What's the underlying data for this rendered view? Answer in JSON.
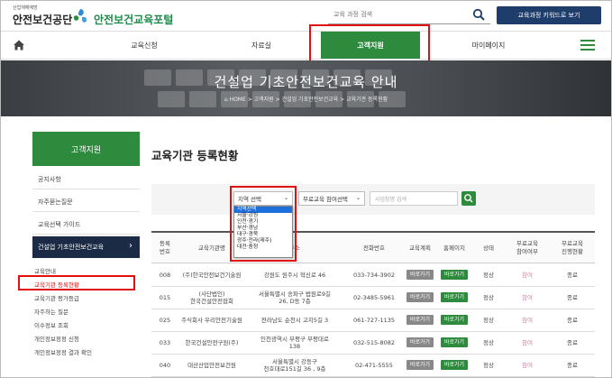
{
  "header": {
    "logo_small": "산업재해예방",
    "logo_main": "안전보건공단",
    "logo_portal": "안전보건교육포털",
    "search_placeholder": "교육 과정 검색",
    "keyword_button": "교육과정 키워드로 보기"
  },
  "nav": {
    "items": [
      "교육신청",
      "자료실",
      "고객지원",
      "마이페이지"
    ],
    "active_index": 2
  },
  "banner": {
    "title": "건설업 기초안전보건교육 안내",
    "breadcrumb": [
      "HOME",
      "고객지원",
      "건설업 기초안전보건교육",
      "교육기관 등록현황"
    ]
  },
  "sidebar": {
    "heading": "고객지원",
    "links": [
      "공지사항",
      "자주묻는질문",
      "교육선택 가이드"
    ],
    "active_section": "건설업 기초안전보건교육",
    "sub_links": [
      "교육안내",
      "교육기관 등록현황",
      "교육기관 평가등급",
      "자주하는 질문",
      "이수정보 조회",
      "개인정보정정 신청",
      "개인정보정정 결과 확인"
    ],
    "sub_active_index": 1
  },
  "content": {
    "title": "교육기관 등록현황",
    "region_select": "지역 선택",
    "free_select": "무료교육 참여선택",
    "institution_placeholder": "사업장명 검색",
    "region_options": [
      "지역선택",
      "서울·강원",
      "인천·경기",
      "부산·경남",
      "대구·경북",
      "광주·전라(제주)",
      "대전·충청"
    ],
    "region_selected_index": 0
  },
  "table": {
    "headers": [
      "등록\n번호",
      "교육기관명",
      "주소",
      "전화번호",
      "교육계획",
      "홈페이지",
      "상태",
      "무료교육\n참여여부",
      "무료교육\n진행현황"
    ],
    "button_labels": {
      "plan": "바로가기",
      "home": "바로가기"
    },
    "rows": [
      {
        "no": "008",
        "name": "(주)한국안전보건기술원",
        "address": "강원도 원주시 혁신로 46",
        "phone": "033-734-3902",
        "status": "정상",
        "free_join": "참여",
        "free_state": "종료"
      },
      {
        "no": "015",
        "name": "(사단법인)\n한국건설안전협회",
        "address": "서울특별시 송파구 법원로9길\n26, D동 7층",
        "phone": "02-3485-5961",
        "status": "정상",
        "free_join": "참여",
        "free_state": "종료"
      },
      {
        "no": "025",
        "name": "주식회사 우리안전기술원",
        "address": "전라남도 순천시 고지5길 3",
        "phone": "061-727-1135",
        "status": "정상",
        "free_join": "참여",
        "free_state": "종료"
      },
      {
        "no": "033",
        "name": "한국건설안전구원(주)",
        "address": "인천광역시 부평구 부평대로\n138",
        "phone": "032-515-8082",
        "status": "정상",
        "free_join": "참여",
        "free_state": "종료"
      },
      {
        "no": "040",
        "name": "대산산업안전보건원",
        "address": "서울특별시 강동구\n천호대로151길 36 , 9층",
        "phone": "02-471-5555",
        "status": "정상",
        "free_join": "참여",
        "free_state": "종료"
      }
    ]
  },
  "colors": {
    "green": "#2e8b3e",
    "navy": "#1c2b45",
    "highlight": "#e01010",
    "link_pink": "#e07aa6"
  }
}
